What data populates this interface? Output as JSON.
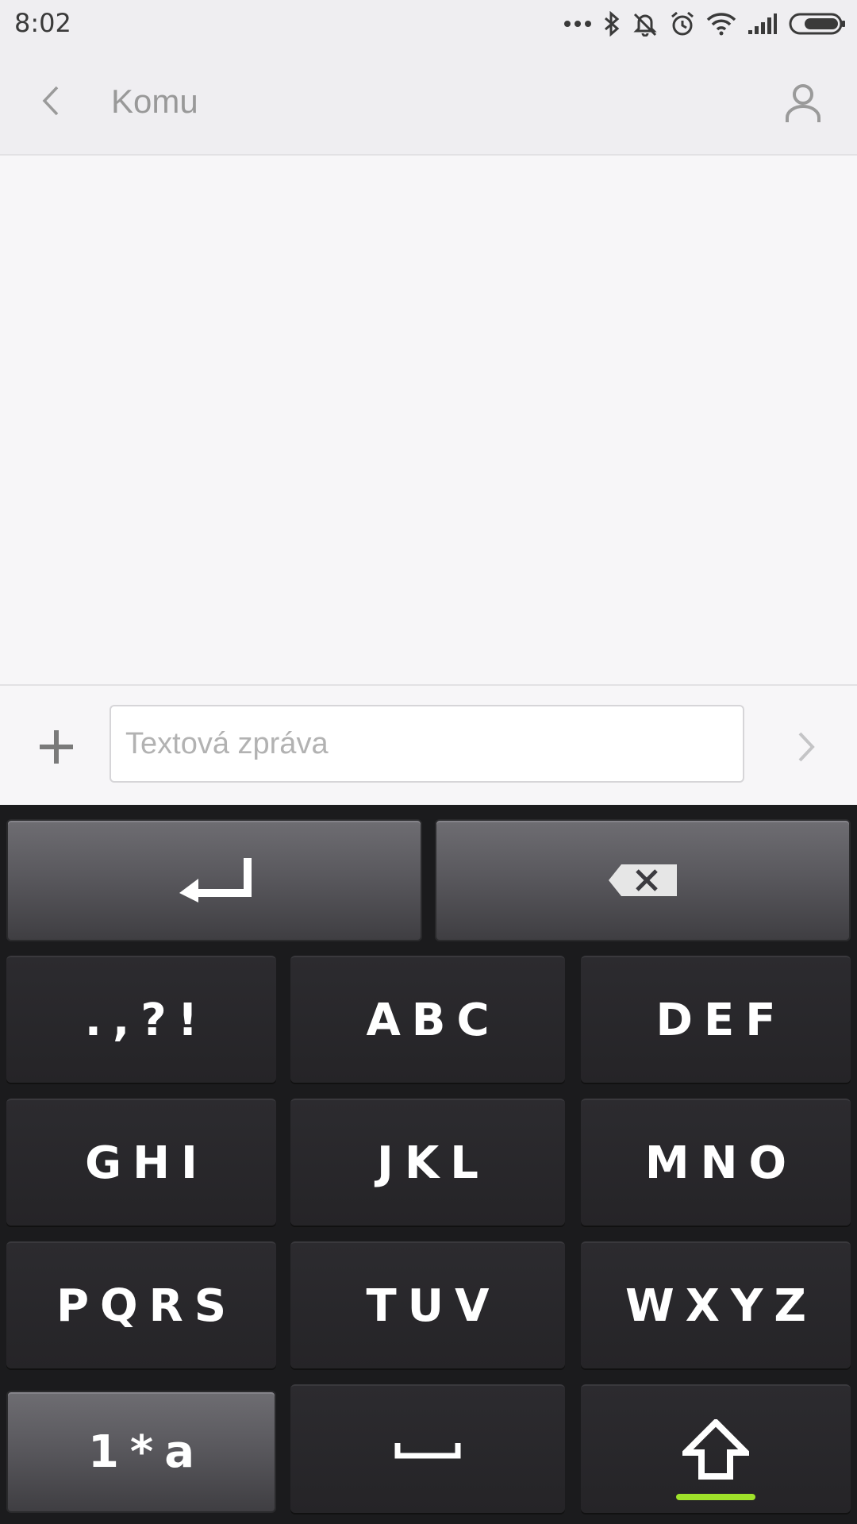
{
  "status_bar": {
    "time": "8:02",
    "icons": [
      "more-dots-icon",
      "bluetooth-icon",
      "notifications-off-icon",
      "alarm-icon",
      "wifi-icon",
      "signal-icon",
      "battery-icon"
    ]
  },
  "header": {
    "title": "Komu",
    "back_icon": "chevron-left-icon",
    "contact_icon": "person-icon"
  },
  "compose": {
    "placeholder": "Textová zpráva",
    "value": "",
    "attach_icon": "plus-icon",
    "send_icon": "chevron-right-icon"
  },
  "keyboard": {
    "enter_icon": "enter-icon",
    "backspace_icon": "backspace-icon",
    "keys": [
      ".,?!",
      "ABC",
      "DEF",
      "GHI",
      "JKL",
      "MNO",
      "PQRS",
      "TUV",
      "WXYZ"
    ],
    "mode_label": "1*a",
    "space_icon": "space-icon",
    "shift_icon": "shift-icon"
  },
  "colors": {
    "accent_shift": "#9fe22a",
    "keyboard_bg": "#1b1b1d",
    "header_bg": "#efeef1"
  }
}
